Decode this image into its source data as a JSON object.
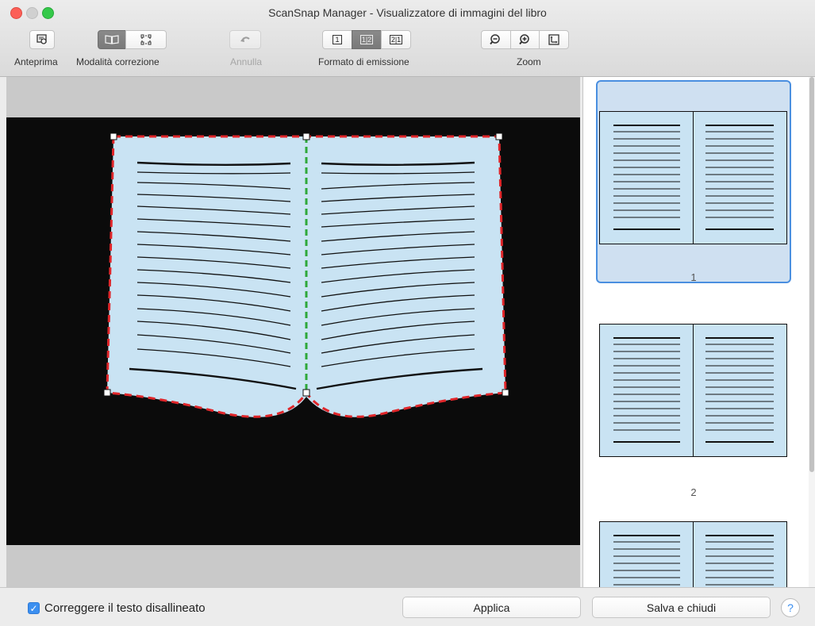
{
  "window": {
    "title": "ScanSnap Manager - Visualizzatore di immagini del libro"
  },
  "toolbar": {
    "preview_label": "Anteprima",
    "correction_mode_label": "Modalità correzione",
    "undo_label": "Annulla",
    "output_format_label": "Formato di emissione",
    "output_format_options": [
      "1",
      "1|2",
      "2|1"
    ],
    "zoom_label": "Zoom",
    "icons": {
      "preview": "preview-icon",
      "book_mode": "open-book-icon",
      "crop_mode": "crop-points-icon",
      "undo": "undo-arrow-icon",
      "zoom_out": "zoom-out-icon",
      "zoom_in": "zoom-in-icon",
      "fit": "fit-to-page-icon"
    }
  },
  "thumbnails": {
    "items": [
      {
        "number": "1",
        "selected": true
      },
      {
        "number": "2",
        "selected": false
      },
      {
        "number": "",
        "selected": false
      }
    ]
  },
  "bottom": {
    "checkbox_label": "Correggere il testo disallineato",
    "checkbox_checked": true,
    "apply_label": "Applica",
    "save_close_label": "Salva e chiudi",
    "help_label": "?"
  },
  "colors": {
    "page_fill": "#c9e3f3",
    "outline_red": "#e0262a",
    "spine_green": "#2fa83a",
    "selection_blue": "#4a8fe0"
  }
}
